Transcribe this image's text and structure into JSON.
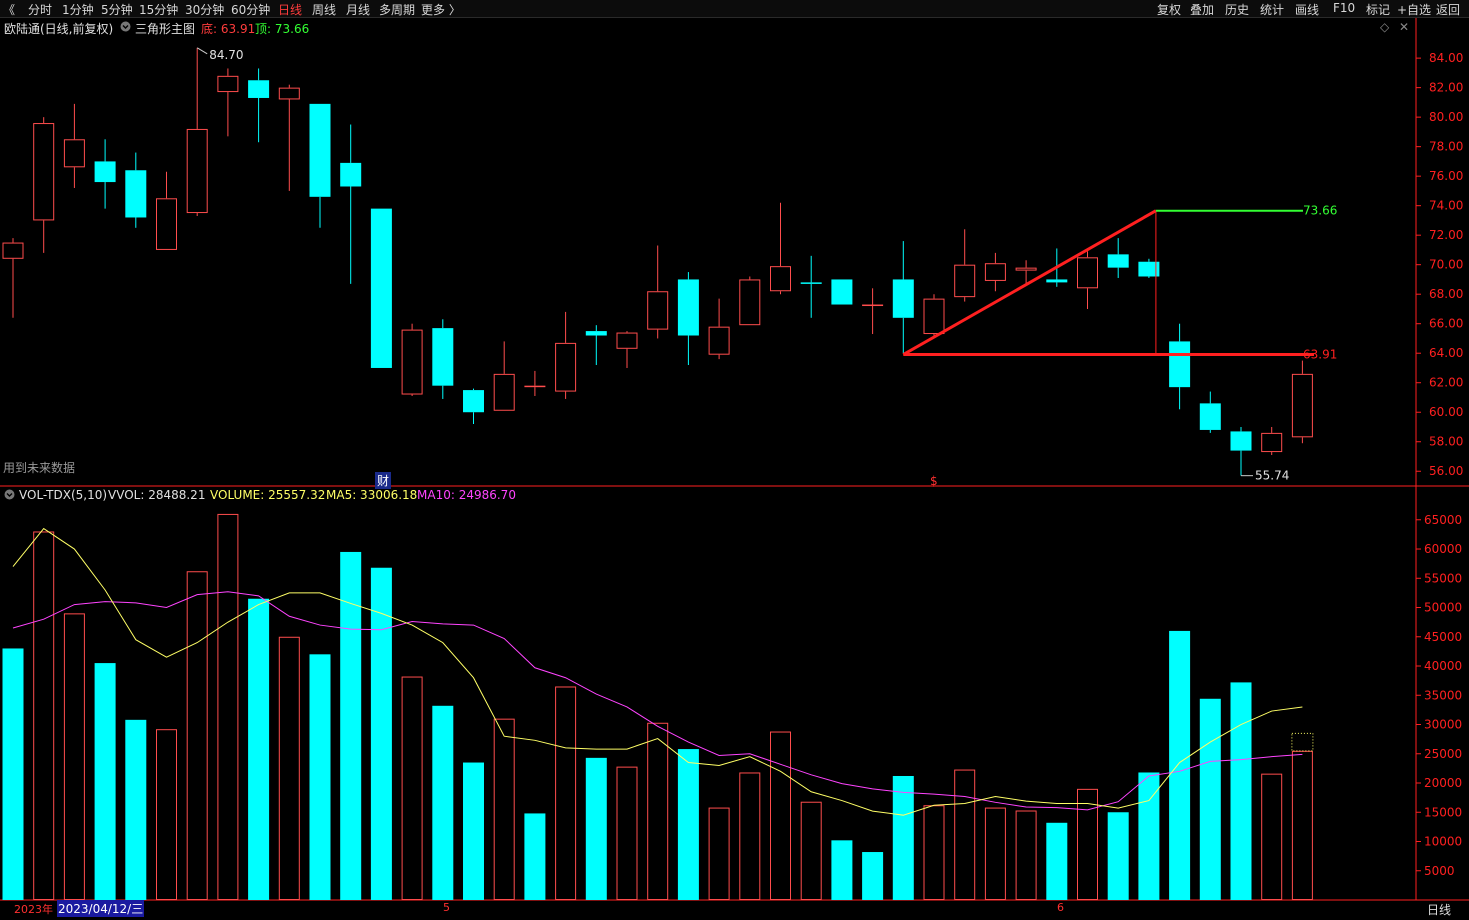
{
  "toolbar": {
    "left_icon": "《",
    "periods": [
      "分时",
      "1分钟",
      "5分钟",
      "15分钟",
      "30分钟",
      "60分钟",
      "日线",
      "周线",
      "月线",
      "多周期",
      "更多 〉"
    ],
    "active_period": "日线",
    "right_buttons": [
      "复权",
      "叠加",
      "历史",
      "统计",
      "画线",
      "F10",
      "标记",
      "+自选",
      "返回"
    ]
  },
  "info": {
    "stock": "欧陆通(日线,前复权)",
    "indicator_icon": "chevron-down-icon",
    "indicator": "三角形主图",
    "bottom_label": "底: 63.91",
    "top_label": "顶: 73.66",
    "future_data_note": "用到未来数据",
    "marker_cai": "财",
    "marker_s": "$"
  },
  "volume_info": {
    "label": "VOL-TDX(5,10)",
    "vvol": "VVOL: 28488.21",
    "volume": "VOLUME: 25557.32",
    "ma5": "MA5: 33006.18",
    "ma10": "MA10: 24986.70"
  },
  "bottom": {
    "year": "2023年",
    "date_cursor": "2023/04/12/三",
    "month_5": "5",
    "month_6": "6",
    "period_button": "日线"
  },
  "colors": {
    "up": "#ff4d4d",
    "down": "#00ffff",
    "axis": "#ff2020",
    "ma5": "#ffff66",
    "ma10": "#ff44ff",
    "top_line": "#33ff33",
    "bottom_line": "#ff2020"
  },
  "chart_data": [
    {
      "type": "candlestick",
      "title": "三角形主图",
      "ylim": [
        55,
        85.5
      ],
      "y_ticks": [
        "84.00",
        "82.00",
        "80.00",
        "78.00",
        "76.00",
        "74.00",
        "72.00",
        "70.00",
        "68.00",
        "66.00",
        "64.00",
        "62.00",
        "60.00",
        "58.00",
        "56.00"
      ],
      "candles": [
        {
          "o": 70.4,
          "h": 71.8,
          "l": 66.4,
          "c": 71.5
        },
        {
          "o": 73.0,
          "h": 80.0,
          "l": 70.8,
          "c": 79.6
        },
        {
          "o": 76.6,
          "h": 80.9,
          "l": 75.2,
          "c": 78.5
        },
        {
          "o": 77.0,
          "h": 78.5,
          "l": 73.8,
          "c": 75.6
        },
        {
          "o": 76.4,
          "h": 77.6,
          "l": 72.5,
          "c": 73.2
        },
        {
          "o": 71.0,
          "h": 76.3,
          "l": 71.0,
          "c": 74.5
        },
        {
          "o": 73.5,
          "h": 84.7,
          "l": 73.3,
          "c": 79.2
        },
        {
          "o": 81.7,
          "h": 83.3,
          "l": 78.7,
          "c": 82.8
        },
        {
          "o": 82.5,
          "h": 83.3,
          "l": 78.3,
          "c": 81.3
        },
        {
          "o": 81.2,
          "h": 82.2,
          "l": 75.0,
          "c": 82.0
        },
        {
          "o": 80.9,
          "h": 80.9,
          "l": 72.5,
          "c": 74.6
        },
        {
          "o": 76.9,
          "h": 79.5,
          "l": 68.7,
          "c": 75.3
        },
        {
          "o": 73.8,
          "h": 73.8,
          "l": 63.0,
          "c": 63.0
        },
        {
          "o": 61.2,
          "h": 66.0,
          "l": 61.1,
          "c": 65.6
        },
        {
          "o": 65.7,
          "h": 66.3,
          "l": 60.9,
          "c": 61.8
        },
        {
          "o": 61.5,
          "h": 61.6,
          "l": 59.2,
          "c": 60.0
        },
        {
          "o": 60.1,
          "h": 64.8,
          "l": 60.1,
          "c": 62.6
        },
        {
          "o": 61.7,
          "h": 62.8,
          "l": 61.1,
          "c": 61.8
        },
        {
          "o": 61.4,
          "h": 66.8,
          "l": 60.9,
          "c": 64.7
        },
        {
          "o": 65.5,
          "h": 65.9,
          "l": 63.2,
          "c": 65.2
        },
        {
          "o": 64.3,
          "h": 65.5,
          "l": 63.0,
          "c": 65.4
        },
        {
          "o": 65.6,
          "h": 71.3,
          "l": 65.0,
          "c": 68.2
        },
        {
          "o": 69.0,
          "h": 69.5,
          "l": 63.2,
          "c": 65.2
        },
        {
          "o": 63.9,
          "h": 67.7,
          "l": 63.6,
          "c": 65.8
        },
        {
          "o": 65.9,
          "h": 69.2,
          "l": 65.9,
          "c": 69.0
        },
        {
          "o": 68.2,
          "h": 74.2,
          "l": 68.0,
          "c": 69.9
        },
        {
          "o": 68.8,
          "h": 70.6,
          "l": 66.4,
          "c": 68.7
        },
        {
          "o": 69.0,
          "h": 69.0,
          "l": 67.3,
          "c": 67.3
        },
        {
          "o": 67.3,
          "h": 68.4,
          "l": 65.3,
          "c": 67.3
        },
        {
          "o": 69.0,
          "h": 71.6,
          "l": 64.0,
          "c": 66.4
        },
        {
          "o": 65.3,
          "h": 68.0,
          "l": 65.0,
          "c": 67.7
        },
        {
          "o": 67.8,
          "h": 72.4,
          "l": 67.5,
          "c": 70.0
        },
        {
          "o": 68.9,
          "h": 70.8,
          "l": 68.2,
          "c": 70.1
        },
        {
          "o": 69.6,
          "h": 70.3,
          "l": 68.7,
          "c": 69.8
        },
        {
          "o": 69.0,
          "h": 71.1,
          "l": 68.5,
          "c": 68.8
        },
        {
          "o": 68.4,
          "h": 70.9,
          "l": 67.0,
          "c": 70.5
        },
        {
          "o": 70.7,
          "h": 71.8,
          "l": 69.1,
          "c": 69.8
        },
        {
          "o": 70.2,
          "h": 70.4,
          "l": 69.1,
          "c": 69.2
        },
        {
          "o": 64.8,
          "h": 66.0,
          "l": 60.2,
          "c": 61.7
        },
        {
          "o": 60.6,
          "h": 61.4,
          "l": 58.6,
          "c": 58.8
        },
        {
          "o": 58.7,
          "h": 59.0,
          "l": 55.7,
          "c": 57.4
        },
        {
          "o": 57.3,
          "h": 59.0,
          "l": 57.1,
          "c": 58.6
        },
        {
          "o": 58.3,
          "h": 63.5,
          "l": 57.9,
          "c": 62.6
        }
      ],
      "annotations": {
        "high_label": "84.70",
        "low_label": "55.74",
        "top_value": "73.66",
        "bottom_value": "63.91",
        "top": 73.66,
        "bottom": 63.91,
        "triangle_start_index": 29,
        "triangle_apex_index": 37,
        "high_index": 6,
        "low_index": 40
      }
    },
    {
      "type": "bar",
      "title": "VOL-TDX(5,10)",
      "ylim": [
        0,
        66500
      ],
      "y_ticks": [
        "65000",
        "60000",
        "55000",
        "50000",
        "45000",
        "40000",
        "35000",
        "30000",
        "25000",
        "20000",
        "15000",
        "10000",
        "5000"
      ],
      "values": [
        43000,
        63000,
        49000,
        40500,
        30800,
        29200,
        56200,
        66000,
        51500,
        45000,
        42000,
        59500,
        56800,
        38200,
        33200,
        23500,
        31000,
        14800,
        36500,
        24300,
        22800,
        30300,
        25800,
        15800,
        21800,
        28800,
        16800,
        10200,
        8200,
        21200,
        16200,
        22300,
        15800,
        15300,
        13200,
        19000,
        15000,
        21800,
        46000,
        34400,
        37200,
        21600,
        25500
      ],
      "up": [
        false,
        true,
        true,
        false,
        false,
        true,
        true,
        true,
        false,
        true,
        false,
        false,
        false,
        true,
        false,
        false,
        true,
        false,
        true,
        false,
        true,
        true,
        false,
        true,
        true,
        true,
        true,
        false,
        false,
        false,
        true,
        true,
        true,
        true,
        false,
        true,
        false,
        false,
        false,
        false,
        false,
        true,
        true
      ],
      "ma5": [
        57000,
        63500,
        60000,
        53000,
        44500,
        41500,
        44000,
        47500,
        50500,
        52500,
        52500,
        50700,
        49000,
        47000,
        44000,
        38000,
        28000,
        27300,
        26000,
        25800,
        25800,
        27600,
        23500,
        23000,
        24500,
        22000,
        18500,
        17000,
        15200,
        14500,
        16200,
        16500,
        17700,
        16900,
        16500,
        16500,
        15700,
        17000,
        23500,
        27000,
        30000,
        32300,
        33000
      ],
      "ma10": [
        46500,
        48000,
        50500,
        51000,
        50800,
        50000,
        52200,
        52700,
        52000,
        48500,
        47000,
        46300,
        46200,
        47600,
        47200,
        47000,
        44700,
        39700,
        38000,
        35200,
        33000,
        29700,
        27000,
        24700,
        25000,
        23200,
        21400,
        19900,
        19000,
        18400,
        18100,
        17700,
        16700,
        15900,
        15800,
        15400,
        16800,
        21200,
        22000,
        23700,
        24000,
        24500,
        24900
      ]
    }
  ]
}
